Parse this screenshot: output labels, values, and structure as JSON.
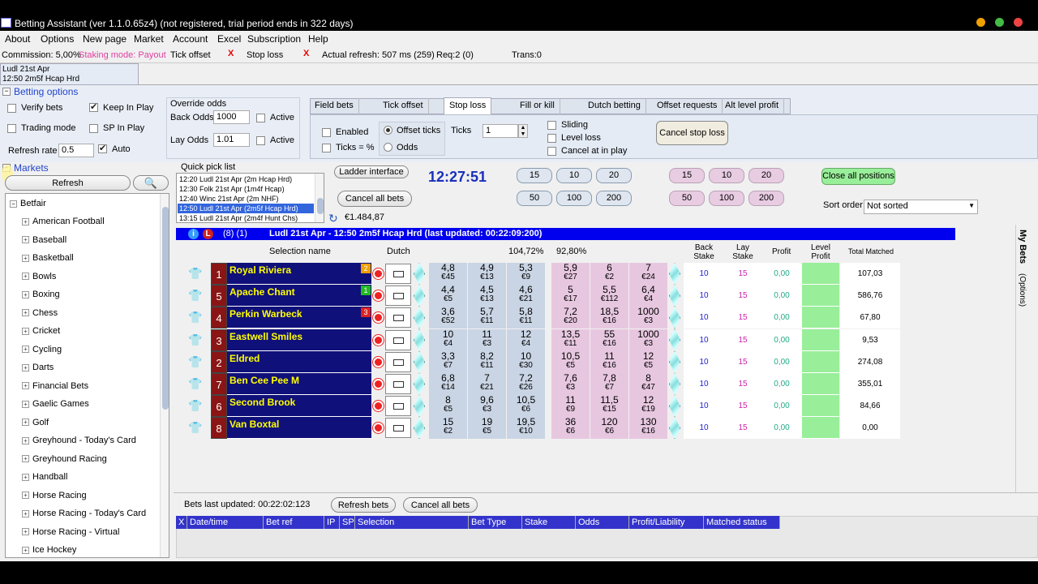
{
  "window": {
    "title": "Betting Assistant (ver 1.1.0.65z4)    (not registered, trial period ends in 322 days)"
  },
  "menu": [
    "About",
    "Options",
    "New page",
    "Market",
    "Account",
    "Excel",
    "Subscription",
    "Help"
  ],
  "status": {
    "commission": "Commission: 5,00%",
    "staking": "Staking mode: Payout",
    "tick_offset": "Tick offset",
    "x1": "X",
    "stop_loss": "Stop loss",
    "x2": "X",
    "refresh": "Actual refresh: 507 ms (259)",
    "req": "Req:2 (0)",
    "trans": "Trans:0"
  },
  "market_tab": {
    "line1": "Ludl 21st Apr",
    "line2": "12:50 2m5f Hcap Hrd"
  },
  "betting_options": {
    "header": "Betting options",
    "verify": "Verify bets",
    "keep_in_play": "Keep In Play",
    "trading": "Trading mode",
    "sp_in_play": "SP In Play",
    "refresh_rate": "Refresh rate",
    "refresh_value": "0.5",
    "auto": "Auto"
  },
  "override": {
    "title": "Override odds",
    "back_label": "Back Odds",
    "back_value": "1000",
    "lay_label": "Lay Odds",
    "lay_value": "1.01",
    "active": "Active"
  },
  "tabs": [
    "Field bets",
    "Tick offset",
    "Stop loss",
    "Fill or kill",
    "Dutch betting",
    "Offset requests",
    "Alt level profit"
  ],
  "stoploss": {
    "enabled": "Enabled",
    "ticks_pct": "Ticks = %",
    "offset_ticks": "Offset ticks",
    "odds": "Odds",
    "ticks_label": "Ticks",
    "ticks_value": "1",
    "sliding": "Sliding",
    "level_loss": "Level loss",
    "cancel_in_play": "Cancel at in play",
    "cancel_btn": "Cancel stop loss"
  },
  "markets": {
    "header": "Markets",
    "refresh": "Refresh",
    "root": "Betfair",
    "items": [
      "American Football",
      "Baseball",
      "Basketball",
      "Bowls",
      "Boxing",
      "Chess",
      "Cricket",
      "Cycling",
      "Darts",
      "Financial Bets",
      "Gaelic Games",
      "Golf",
      "Greyhound - Today's Card",
      "Greyhound Racing",
      "Handball",
      "Horse Racing",
      "Horse Racing - Today's Card",
      "Horse Racing - Virtual",
      "Ice Hockey"
    ]
  },
  "quickpick": {
    "title": "Quick pick list",
    "items": [
      "12:20 Ludl 21st Apr (2m Hcap Hrd)",
      "12:30 Folk 21st Apr (1m4f Hcap)",
      "12:40 Winc 21st Apr (2m NHF)",
      "12:50 Ludl 21st Apr (2m5f Hcap Hrd)",
      "13:15 Ludl 21st Apr (2m4f Hunt Chs)"
    ]
  },
  "controls": {
    "ladder": "Ladder interface",
    "cancel_all": "Cancel all bets",
    "clock": "12:27:51",
    "balance": "€1.484,87",
    "close_all": "Close all positions",
    "sort_label": "Sort order",
    "sort_value": "Not sorted",
    "back_stakes": [
      "15",
      "10",
      "20",
      "50",
      "100",
      "200"
    ],
    "lay_stakes": [
      "15",
      "10",
      "20",
      "50",
      "100",
      "200"
    ]
  },
  "market_bar": {
    "counts": "(8) (1)",
    "title": "Ludl 21st Apr - 12:50 2m5f Hcap Hrd (last updated: 00:22:09:200)"
  },
  "columns": {
    "selection": "Selection name",
    "dutch": "Dutch",
    "back_pct": "104,72%",
    "lay_pct": "92,80%",
    "back_stake": "Back Stake",
    "lay_stake": "Lay Stake",
    "profit": "Profit",
    "level_profit": "Level Profit",
    "total_matched": "Total Matched"
  },
  "runners": [
    {
      "no": "1",
      "name": "Royal Riviera",
      "badge": "2",
      "badge_color": "#f0a000",
      "back": [
        [
          "4,8",
          "€45"
        ],
        [
          "4,9",
          "€13"
        ],
        [
          "5,3",
          "€9"
        ]
      ],
      "lay": [
        [
          "5,9",
          "€27"
        ],
        [
          "6",
          "€2"
        ],
        [
          "7",
          "€24"
        ]
      ],
      "bs": "10",
      "ls": "15",
      "profit": "0,00",
      "matched": "107,03"
    },
    {
      "no": "5",
      "name": "Apache Chant",
      "badge": "1",
      "badge_color": "#22bb22",
      "back": [
        [
          "4,4",
          "€5"
        ],
        [
          "4,5",
          "€13"
        ],
        [
          "4,6",
          "€21"
        ]
      ],
      "lay": [
        [
          "5",
          "€17"
        ],
        [
          "5,5",
          "€112"
        ],
        [
          "6,4",
          "€4"
        ]
      ],
      "bs": "10",
      "ls": "15",
      "profit": "0,00",
      "matched": "586,76"
    },
    {
      "no": "4",
      "name": "Perkin Warbeck",
      "badge": "3",
      "badge_color": "#dd2222",
      "back": [
        [
          "3,6",
          "€52"
        ],
        [
          "5,7",
          "€11"
        ],
        [
          "5,8",
          "€11"
        ]
      ],
      "lay": [
        [
          "7,2",
          "€20"
        ],
        [
          "18,5",
          "€16"
        ],
        [
          "1000",
          "€3"
        ]
      ],
      "bs": "10",
      "ls": "15",
      "profit": "0,00",
      "matched": "67,80"
    },
    {
      "no": "3",
      "name": "Eastwell Smiles",
      "badge": "",
      "badge_color": "",
      "back": [
        [
          "10",
          "€4"
        ],
        [
          "11",
          "€3"
        ],
        [
          "12",
          "€4"
        ]
      ],
      "lay": [
        [
          "13,5",
          "€11"
        ],
        [
          "55",
          "€16"
        ],
        [
          "1000",
          "€3"
        ]
      ],
      "bs": "10",
      "ls": "15",
      "profit": "0,00",
      "matched": "9,53"
    },
    {
      "no": "2",
      "name": "Eldred",
      "badge": "",
      "badge_color": "",
      "back": [
        [
          "3,3",
          "€7"
        ],
        [
          "8,2",
          "€11"
        ],
        [
          "10",
          "€30"
        ]
      ],
      "lay": [
        [
          "10,5",
          "€5"
        ],
        [
          "11",
          "€16"
        ],
        [
          "12",
          "€5"
        ]
      ],
      "bs": "10",
      "ls": "15",
      "profit": "0,00",
      "matched": "274,08"
    },
    {
      "no": "7",
      "name": "Ben Cee Pee M",
      "badge": "",
      "badge_color": "",
      "back": [
        [
          "6,8",
          "€14"
        ],
        [
          "7",
          "€21"
        ],
        [
          "7,2",
          "€26"
        ]
      ],
      "lay": [
        [
          "7,6",
          "€3"
        ],
        [
          "7,8",
          "€7"
        ],
        [
          "8",
          "€47"
        ]
      ],
      "bs": "10",
      "ls": "15",
      "profit": "0,00",
      "matched": "355,01"
    },
    {
      "no": "6",
      "name": "Second Brook",
      "badge": "",
      "badge_color": "",
      "back": [
        [
          "8",
          "€5"
        ],
        [
          "9,6",
          "€3"
        ],
        [
          "10,5",
          "€6"
        ]
      ],
      "lay": [
        [
          "11",
          "€9"
        ],
        [
          "11,5",
          "€15"
        ],
        [
          "12",
          "€19"
        ]
      ],
      "bs": "10",
      "ls": "15",
      "profit": "0,00",
      "matched": "84,66"
    },
    {
      "no": "8",
      "name": "Van Boxtal",
      "badge": "",
      "badge_color": "",
      "back": [
        [
          "15",
          "€2"
        ],
        [
          "19",
          "€5"
        ],
        [
          "19,5",
          "€10"
        ]
      ],
      "lay": [
        [
          "36",
          "€6"
        ],
        [
          "120",
          "€6"
        ],
        [
          "130",
          "€16"
        ]
      ],
      "bs": "10",
      "ls": "15",
      "profit": "0,00",
      "matched": "0,00"
    }
  ],
  "bets": {
    "last_updated": "Bets last updated: 00:22:02:123",
    "refresh": "Refresh bets",
    "cancel_all": "Cancel all bets",
    "headers": [
      "X",
      "Date/time",
      "Bet ref",
      "IP",
      "SP",
      "Selection",
      "Bet Type",
      "Stake",
      "Odds",
      "Profit/Liability",
      "Matched status"
    ]
  },
  "side": {
    "my_bets": "My Bets",
    "options": "(Options)"
  },
  "colors": {
    "header_blue": "#0000ee",
    "runner_bg": "#10107a",
    "back_cell": "#c9d4e4",
    "lay_cell": "#e7c7e0",
    "level_green": "#99ee99"
  }
}
